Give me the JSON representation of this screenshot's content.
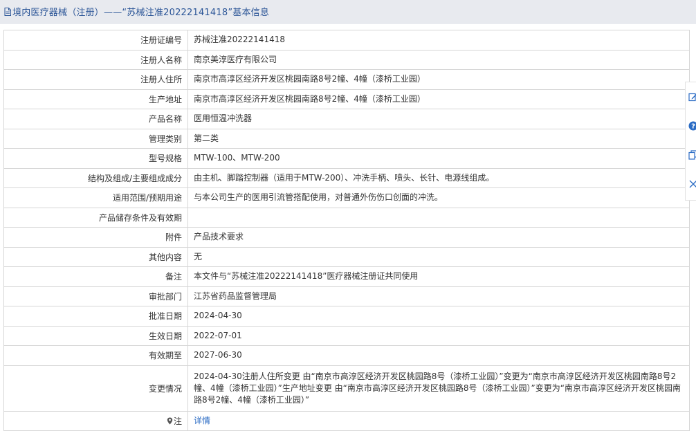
{
  "header": {
    "title": "境内医疗器械（注册）——“苏械注准20222141418”基本信息",
    "icon": "document-icon"
  },
  "rows": [
    {
      "label": "注册证编号",
      "value": "苏械注准20222141418"
    },
    {
      "label": "注册人名称",
      "value": "南京美淳医疗有限公司"
    },
    {
      "label": "注册人住所",
      "value": "南京市高淳区经济开发区桃园南路8号2幢、4幢（漆桥工业园）"
    },
    {
      "label": "生产地址",
      "value": "南京市高淳区经济开发区桃园南路8号2幢、4幢（漆桥工业园）"
    },
    {
      "label": "产品名称",
      "value": "医用恒温冲洗器"
    },
    {
      "label": "管理类别",
      "value": "第二类"
    },
    {
      "label": "型号规格",
      "value": "MTW-100、MTW-200"
    },
    {
      "label": "结构及组成/主要组成成分",
      "value": "由主机、脚踏控制器（适用于MTW-200）、冲洗手柄、喷头、长针、电源线组成。"
    },
    {
      "label": "适用范围/预期用途",
      "value": "与本公司生产的医用引流管搭配使用，对普通外伤伤口创面的冲洗。"
    },
    {
      "label": "产品储存条件及有效期",
      "value": ""
    },
    {
      "label": "附件",
      "value": "产品技术要求"
    },
    {
      "label": "其他内容",
      "value": "无"
    },
    {
      "label": "备注",
      "value": "本文件与“苏械注准20222141418”医疗器械注册证共同使用"
    },
    {
      "label": "审批部门",
      "value": "江苏省药品监督管理局"
    },
    {
      "label": "批准日期",
      "value": "2024-04-30"
    },
    {
      "label": "生效日期",
      "value": "2022-07-01"
    },
    {
      "label": "有效期至",
      "value": "2027-06-30"
    },
    {
      "label": "变更情况",
      "value": "2024-04-30注册人住所变更 由“南京市高淳区经济开发区桃园路8号（漆桥工业园）”变更为“南京市高淳区经济开发区桃园南路8号2幢、4幢（漆桥工业园）”生产地址变更 由“南京市高淳区经济开发区桃园路8号（漆桥工业园）”变更为“南京市高淳区经济开发区桃园南路8号2幢、4幢（漆桥工业园）”"
    }
  ],
  "note_row": {
    "label": "注",
    "link": "详情",
    "icon": "pin-icon"
  },
  "side_tools": [
    "edit-icon",
    "help-icon",
    "copy-icon",
    "close-icon"
  ],
  "colors": {
    "header_bg": "#e8eaef",
    "title": "#2b5597",
    "link": "#2b6cc4",
    "border": "#d6d6d6"
  }
}
